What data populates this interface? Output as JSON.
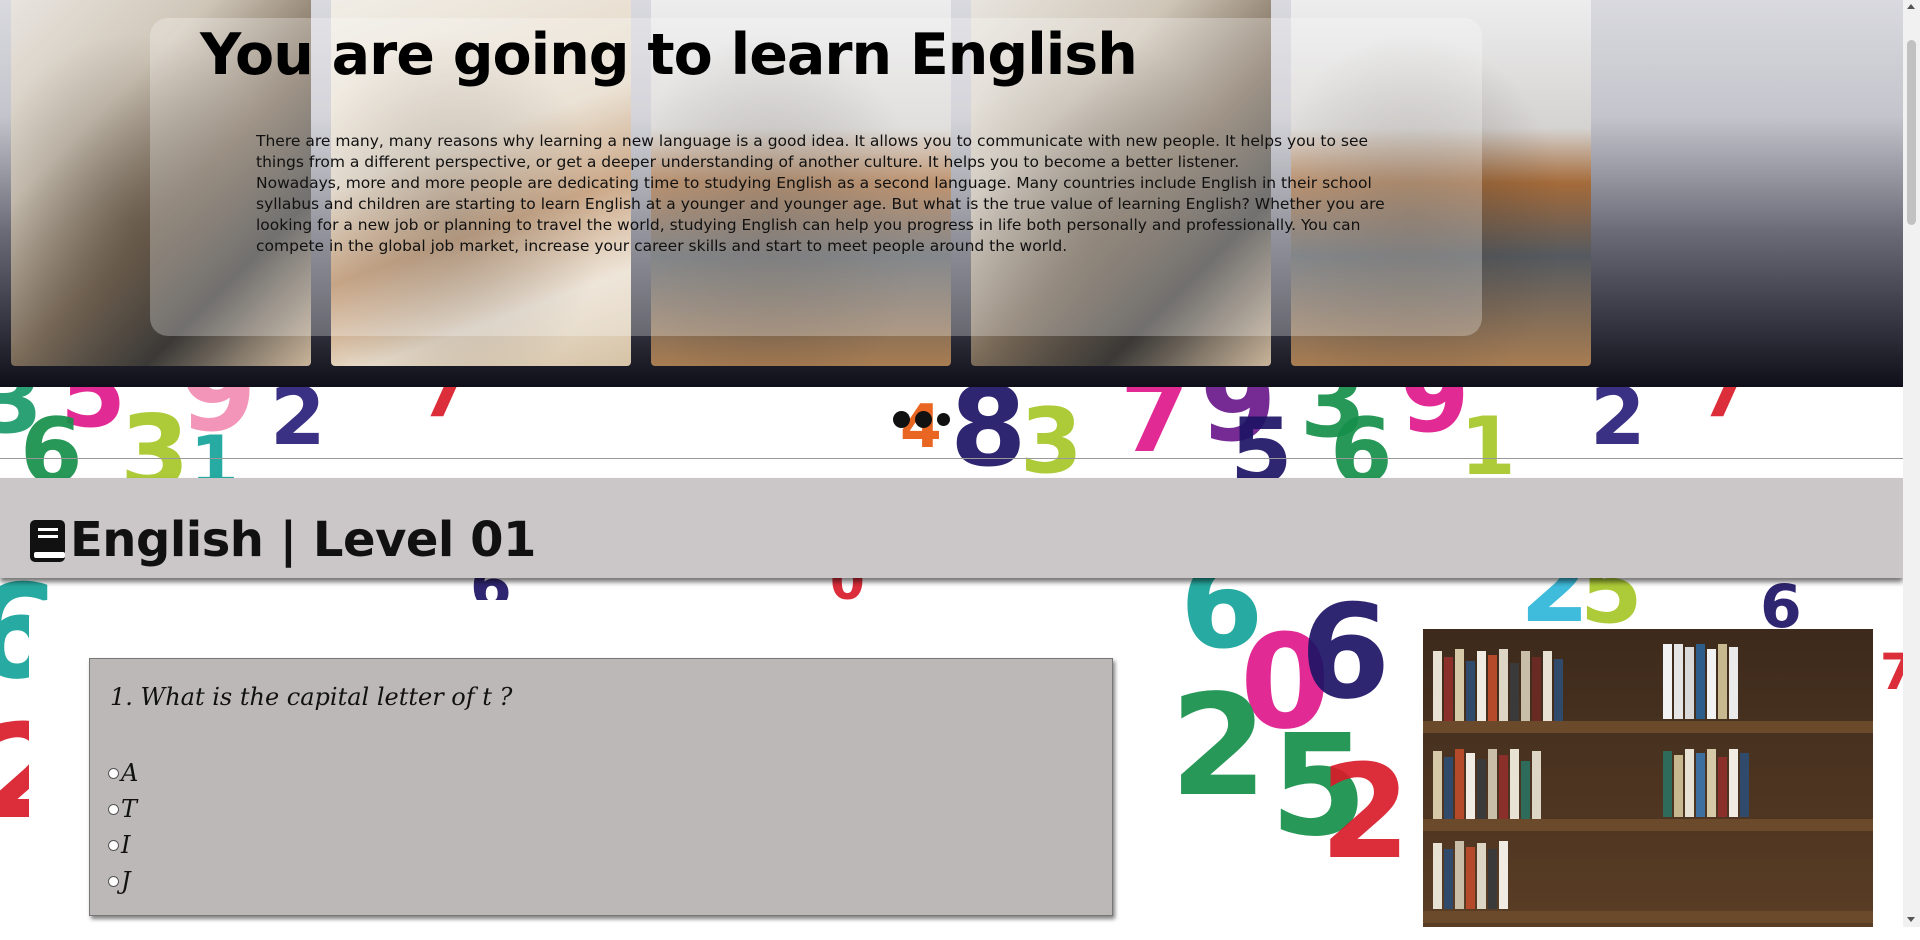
{
  "hero": {
    "title": "You are going to learn English",
    "paragraph_1": "There are many, many reasons why learning a new language is a good idea. It allows you to communicate with new people. It helps you to see things from a different perspective, or get a deeper understanding of another culture. It helps you to become a better listener.",
    "paragraph_2": "Nowadays, more and more people are dedicating time to studying English as a second language. Many countries include English in their school syllabus and children are starting to learn English at a younger and younger age. But what is the true value of learning English? Whether you are looking for a new job or planning to travel the world, studying English can help you progress in life both personally and professionally. You can compete in the global job market, increase your career skills and start to meet people around the world."
  },
  "level": {
    "icon": "book-icon",
    "title": "English | Level 01"
  },
  "quiz": {
    "question": "1. What is the capital letter of t ?",
    "options": [
      "A",
      "T",
      "I",
      "J"
    ]
  },
  "colors": {
    "level_bar": "#cbc6c7",
    "question_box": "#bcb8b8"
  }
}
